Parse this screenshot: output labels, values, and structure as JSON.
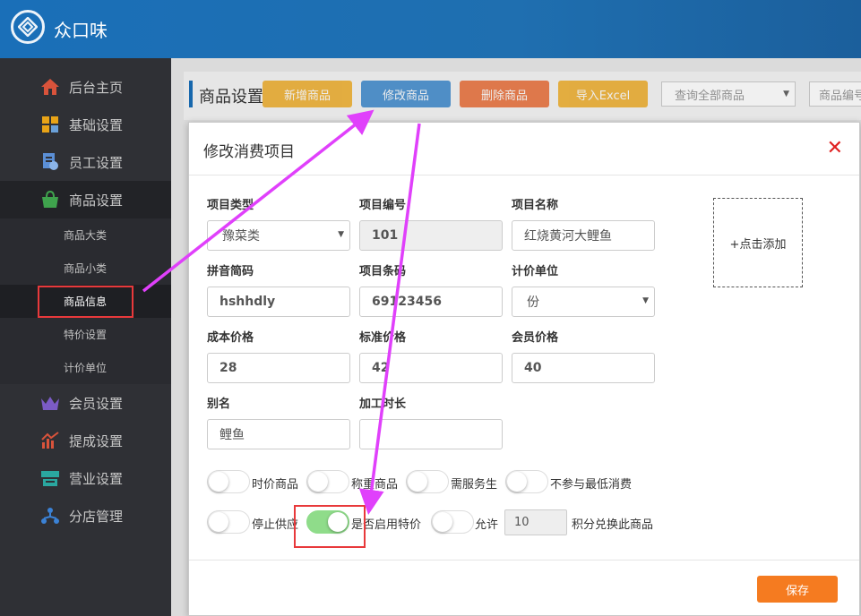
{
  "app": {
    "title": "众口味"
  },
  "sidebar": {
    "items": [
      {
        "label": "后台主页",
        "icon": "home-icon"
      },
      {
        "label": "基础设置",
        "icon": "grid-icon"
      },
      {
        "label": "员工设置",
        "icon": "employee-icon"
      },
      {
        "label": "商品设置",
        "icon": "shopping-bag-icon"
      },
      {
        "label": "会员设置",
        "icon": "crown-icon"
      },
      {
        "label": "提成设置",
        "icon": "chart-icon"
      },
      {
        "label": "营业设置",
        "icon": "register-icon"
      },
      {
        "label": "分店管理",
        "icon": "branch-icon"
      }
    ],
    "sub_items": [
      {
        "label": "商品大类"
      },
      {
        "label": "商品小类"
      },
      {
        "label": "商品信息"
      },
      {
        "label": "特价设置"
      },
      {
        "label": "计价单位"
      }
    ]
  },
  "toolbar": {
    "title": "商品设置",
    "buttons": [
      {
        "label": "新增商品",
        "color": "#f0a30a"
      },
      {
        "label": "修改商品",
        "color": "#1f78c8"
      },
      {
        "label": "删除商品",
        "color": "#ea5a1a"
      },
      {
        "label": "导入Excel",
        "color": "#f0a30a"
      }
    ],
    "filter_select": "查询全部商品",
    "search_placeholder": "商品编号"
  },
  "modal": {
    "title": "修改消费项目",
    "close": "✕",
    "fields": {
      "type": {
        "label": "项目类型",
        "value": "豫菜类"
      },
      "code": {
        "label": "项目编号",
        "value": "101"
      },
      "name": {
        "label": "项目名称",
        "value": "红烧黄河大鲤鱼"
      },
      "pinyin": {
        "label": "拼音简码",
        "value": "hshhdly"
      },
      "barcode": {
        "label": "项目条码",
        "value": "69123456"
      },
      "unit": {
        "label": "计价单位",
        "value": "份"
      },
      "cost": {
        "label": "成本价格",
        "value": "28"
      },
      "standard": {
        "label": "标准价格",
        "value": "42"
      },
      "member": {
        "label": "会员价格",
        "value": "40"
      },
      "alias": {
        "label": "别名",
        "value": "鲤鱼"
      },
      "duration": {
        "label": "加工时长",
        "value": ""
      }
    },
    "image_add": "+点击添加",
    "toggles_row1": [
      {
        "label": "时价商品",
        "on": false
      },
      {
        "label": "称重商品",
        "on": false
      },
      {
        "label": "需服务生",
        "on": false
      },
      {
        "label": "不参与最低消费",
        "on": false
      }
    ],
    "toggles_row2": [
      {
        "label": "停止供应",
        "on": false
      },
      {
        "label": "是否启用特价",
        "on": true
      },
      {
        "label": "允许",
        "on": false
      }
    ],
    "points_value": "10",
    "points_label": "积分兑换此商品",
    "save": "保存"
  },
  "colors": {
    "topbar": "#1a6fb8",
    "sidebar": "#2f3035",
    "annotation_arrow": "#e040fb",
    "highlight_box": "#e8393b",
    "toggle_on": "#8fdc8a"
  }
}
